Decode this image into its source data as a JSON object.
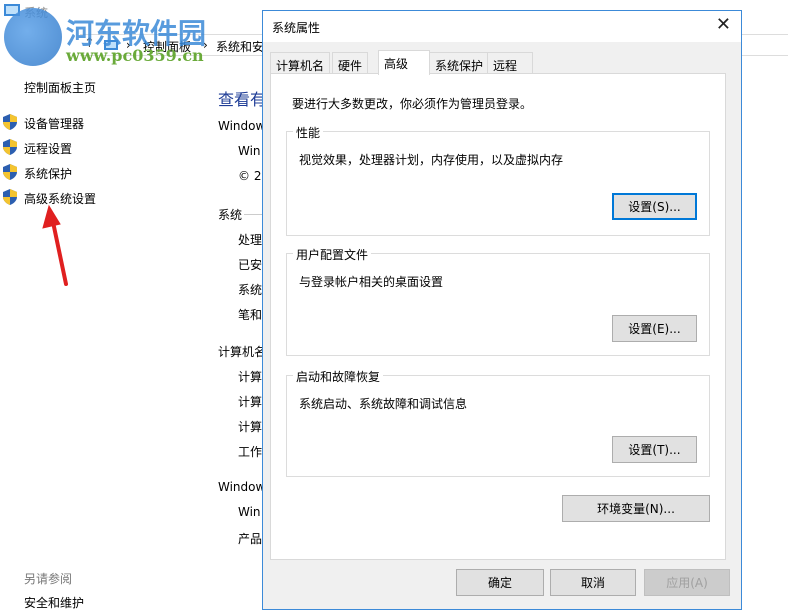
{
  "background_window": {
    "title": "系统",
    "breadcrumb": [
      "控制面板",
      "系统和安"
    ],
    "sidebar": {
      "home": "控制面板主页",
      "items": [
        "设备管理器",
        "远程设置",
        "系统保护",
        "高级系统设置"
      ],
      "see_also": "另请参阅",
      "see_also_items": [
        "安全和维护"
      ]
    },
    "main": {
      "heading": "查看有",
      "lines": [
        {
          "t": "Window",
          "i": 0
        },
        {
          "t": "Win",
          "i": 1
        },
        {
          "t": "© 2",
          "i": 1
        },
        {
          "t": "系统",
          "i": 0
        },
        {
          "t": "处理",
          "i": 1
        },
        {
          "t": "已安",
          "i": 1
        },
        {
          "t": "系统",
          "i": 1
        },
        {
          "t": "笔和",
          "i": 1
        },
        {
          "t": "计算机名",
          "i": 0
        },
        {
          "t": "计算",
          "i": 1
        },
        {
          "t": "计算",
          "i": 1
        },
        {
          "t": "计算",
          "i": 1
        },
        {
          "t": "工作",
          "i": 1
        },
        {
          "t": "Window",
          "i": 0
        },
        {
          "t": "Win",
          "i": 1
        },
        {
          "t": "产品",
          "i": 1
        }
      ]
    }
  },
  "watermark": {
    "name": "河东软件园",
    "url": "www.pc0359.cn"
  },
  "dialog": {
    "title": "系统属性",
    "tabs": [
      "计算机名",
      "硬件",
      "高级",
      "系统保护",
      "远程"
    ],
    "active_tab": "高级",
    "admin_note": "要进行大多数更改，你必须作为管理员登录。",
    "groups": [
      {
        "label": "性能",
        "desc": "视觉效果，处理器计划，内存使用，以及虚拟内存",
        "button": "设置(S)..."
      },
      {
        "label": "用户配置文件",
        "desc": "与登录帐户相关的桌面设置",
        "button": "设置(E)..."
      },
      {
        "label": "启动和故障恢复",
        "desc": "系统启动、系统故障和调试信息",
        "button": "设置(T)..."
      }
    ],
    "env_button": "环境变量(N)...",
    "ok": "确定",
    "cancel": "取消",
    "apply": "应用(A)"
  },
  "colors": {
    "accent": "#0078d7",
    "arrow": "#e02020",
    "heading": "#1e3c96"
  }
}
